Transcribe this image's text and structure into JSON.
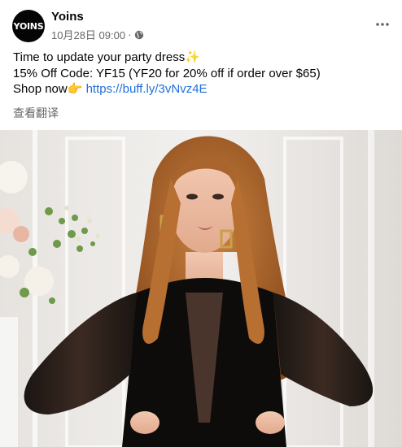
{
  "post": {
    "page_name": "Yoins",
    "avatar_text": "YOINS",
    "timestamp": "10月28日 09:00",
    "separator": "·",
    "privacy_icon": "globe-icon",
    "more_icon": "more-horizontal-icon",
    "text_line_1": "Time to update your party dress",
    "text_line_1_emoji": "✨",
    "text_line_2": "15% Off Code: YF15 (YF20 for 20% off if order over $65)",
    "text_line_3": "Shop now",
    "text_line_3_emoji": "👉",
    "link": "https://buff.ly/3vNvz4E",
    "translate_label": "查看翻译"
  },
  "colors": {
    "text_primary": "#050505",
    "text_secondary": "#65676b",
    "link": "#216fdb"
  },
  "photo": {
    "subject": "woman in black dress with sheer mesh sleeves, hands on hips, white floral arrangement in background"
  }
}
